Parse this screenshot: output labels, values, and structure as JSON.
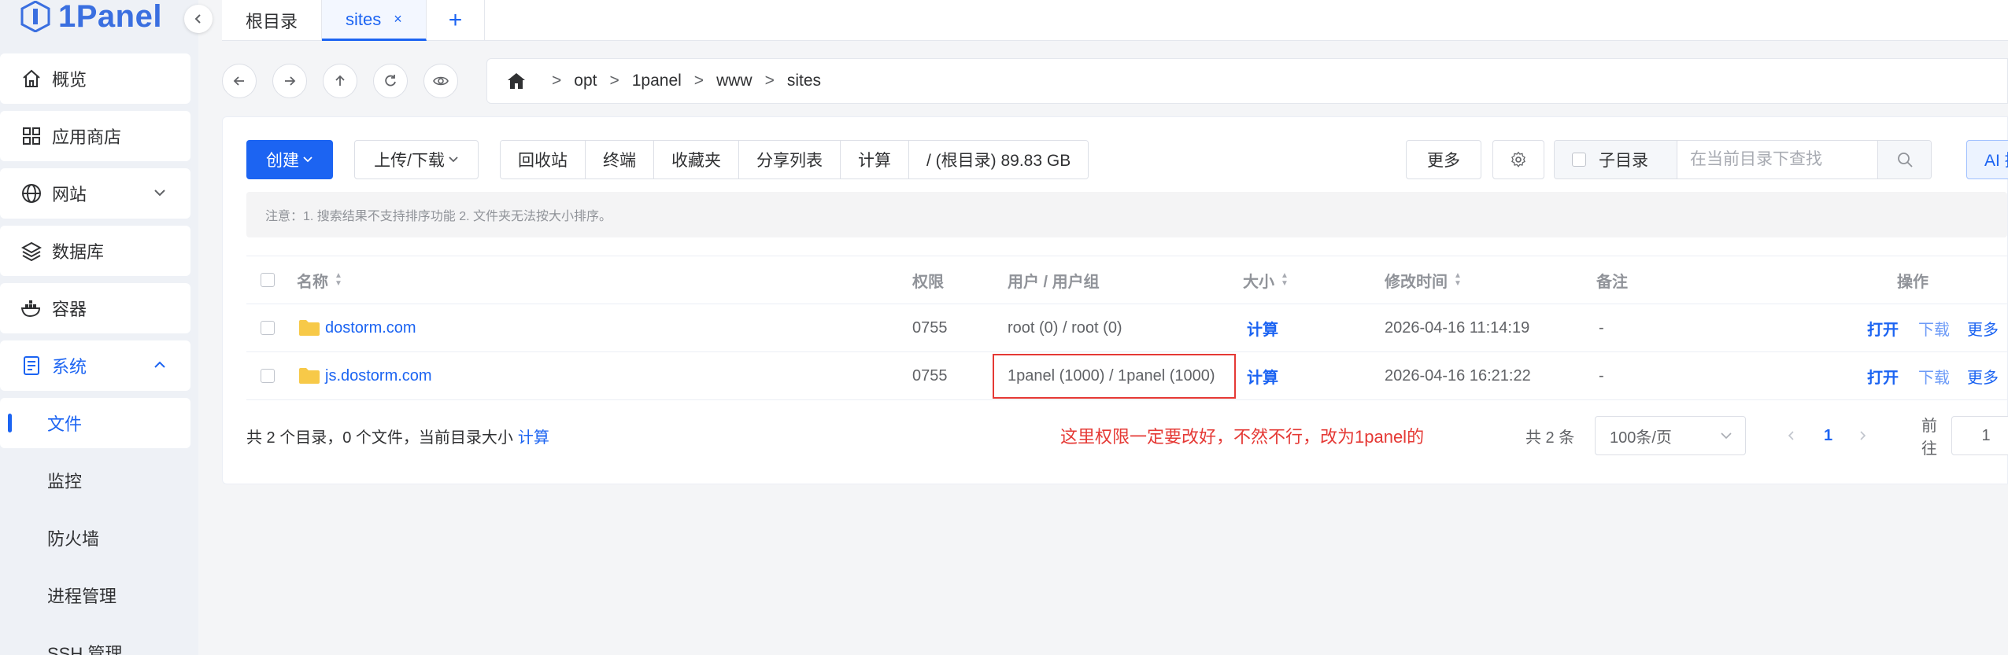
{
  "app": {
    "logo_text": "1Panel",
    "accent": "#1c64f2"
  },
  "sidebar": {
    "items": [
      {
        "label": "概览",
        "icon": "home-icon"
      },
      {
        "label": "应用商店",
        "icon": "grid-icon"
      },
      {
        "label": "网站",
        "icon": "globe-icon",
        "expandable": true
      },
      {
        "label": "数据库",
        "icon": "layers-icon"
      },
      {
        "label": "容器",
        "icon": "docker-icon"
      },
      {
        "label": "系统",
        "icon": "doc-icon",
        "expanded": true
      }
    ],
    "sub_items": [
      {
        "label": "文件",
        "active": true
      },
      {
        "label": "监控"
      },
      {
        "label": "防火墙"
      },
      {
        "label": "进程管理"
      },
      {
        "label": "SSH 管理"
      }
    ]
  },
  "tabs": [
    {
      "label": "根目录"
    },
    {
      "label": "sites",
      "active": true,
      "close": "×"
    },
    {
      "label": "+"
    }
  ],
  "breadcrumb": {
    "separator": ">",
    "parts": [
      "opt",
      "1panel",
      "www",
      "sites"
    ]
  },
  "toolbar": {
    "create_label": "创建",
    "upload_label": "上传/下载",
    "group": [
      "回收站",
      "终端",
      "收藏夹",
      "分享列表",
      "计算",
      "/ (根目录) 89.83 GB"
    ],
    "more_label": "更多",
    "subdir_label": "子目录",
    "search_placeholder": "在当前目录下查找",
    "ai_label": "AI 搜索"
  },
  "notice": "注意：1. 搜索结果不支持排序功能 2. 文件夹无法按大小排序。",
  "table": {
    "columns": {
      "name": "名称",
      "perm": "权限",
      "owner": "用户 / 用户组",
      "size": "大小",
      "mtime": "修改时间",
      "remark": "备注",
      "ops": "操作"
    },
    "rows": [
      {
        "name": "dostorm.com",
        "perm": "0755",
        "owner": "root (0) / root (0)",
        "size": "计算",
        "mtime": "2026-04-16 11:14:19",
        "remark": "-",
        "open": "打开",
        "download": "下载",
        "more": "更多"
      },
      {
        "name": "js.dostorm.com",
        "perm": "0755",
        "owner": "1panel (1000) / 1panel (1000)",
        "size": "计算",
        "mtime": "2026-04-16 16:21:22",
        "remark": "-",
        "open": "打开",
        "download": "下载",
        "more": "更多"
      }
    ]
  },
  "footer": {
    "summary": "共 2 个目录，0 个文件，当前目录大小",
    "summary_link": "计算",
    "annotation": "这里权限一定要改好，不然不行，改为1panel的",
    "total": "共 2 条",
    "page_size": "100条/页",
    "current_page": "1",
    "goto_label": "前往",
    "goto_value": "1"
  }
}
